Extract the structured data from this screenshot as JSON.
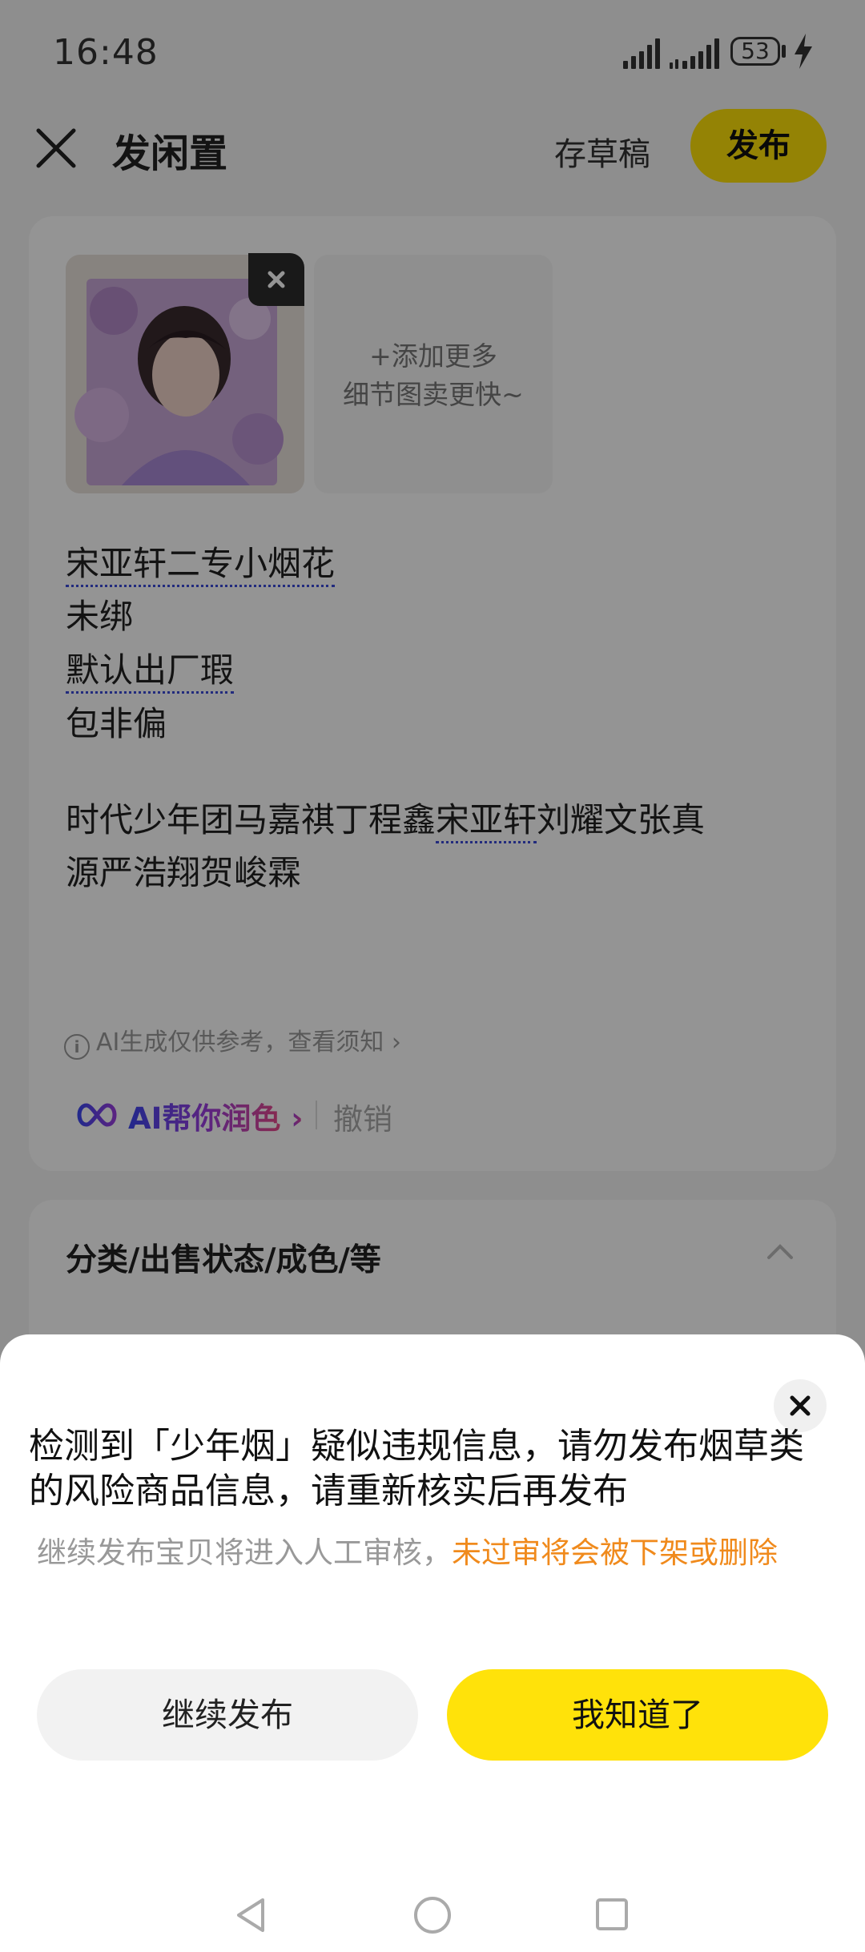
{
  "status": {
    "time": "16:48",
    "battery": "53"
  },
  "header": {
    "title": "发闲置",
    "draft_label": "存草稿",
    "publish_label": "发布"
  },
  "photos": {
    "add_more_line1": "+添加更多",
    "add_more_line2": "细节图卖更快~"
  },
  "description": {
    "lines": [
      "宋亚轩二专小烟花",
      "未绑",
      "默认出厂瑕",
      "包非偏"
    ],
    "para_line1_a": "时代少年团马嘉祺丁程鑫",
    "para_line1_b": "宋亚轩",
    "para_line1_c": "刘耀文张真",
    "para_line2": "源严浩翔贺峻霖"
  },
  "ai": {
    "hint": "AI生成仅供参考，查看须知",
    "polish_label": "AI帮你润色",
    "undo_label": "撤销"
  },
  "category_section": {
    "title": "分类/出售状态/成色/等"
  },
  "dialog": {
    "title": "检测到「少年烟」疑似违规信息，请勿发布烟草类的风险商品信息，请重新核实后再发布",
    "sub_normal": "继续发布宝贝将进入人工审核，",
    "sub_warning": "未过审将会被下架或删除",
    "continue_label": "继续发布",
    "ok_label": "我知道了"
  },
  "colors": {
    "accent": "#ffe20a",
    "warning": "#f08a1c",
    "ai_gradient_start": "#3d47f0",
    "ai_gradient_end": "#e84a8a"
  }
}
